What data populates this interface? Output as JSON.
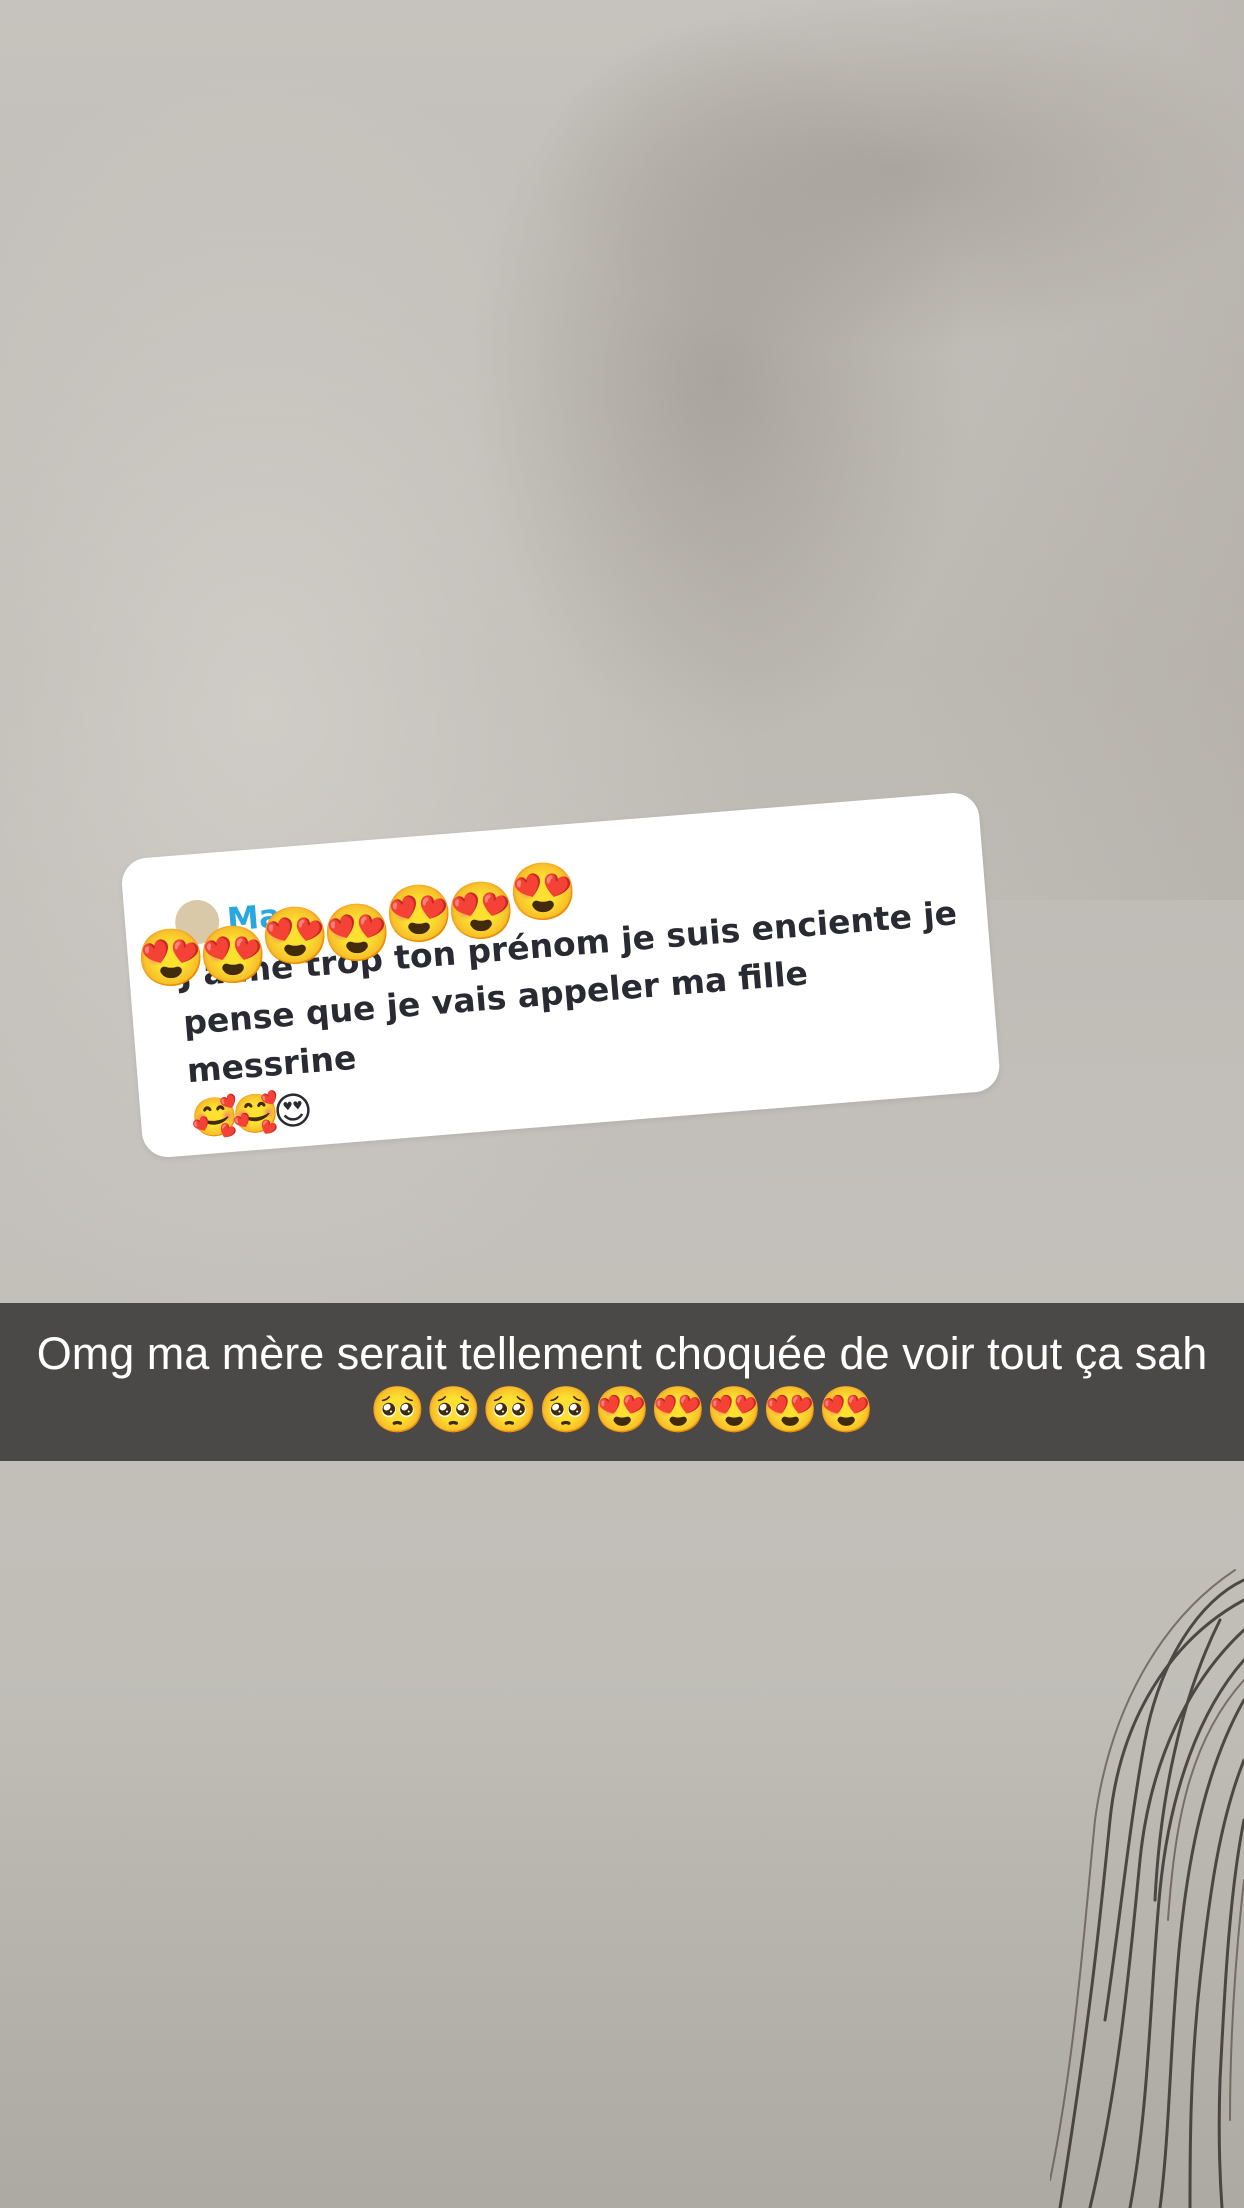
{
  "comment": {
    "username": "Ma",
    "text": "J aime trop ton prénom je suis enciente je pense que je vais appeler ma fille messrine",
    "trailing_emojis": "🥰🥰😍"
  },
  "sticker": {
    "emoji": "😍",
    "count": 7
  },
  "caption": {
    "text": "Omg ma mère serait tellement choquée de voir tout ça sah 🥺🥺🥺🥺😍😍😍😍😍"
  },
  "colors": {
    "username": "#29a8e0",
    "comment_text": "#2a2a33",
    "caption_bar": "#282826",
    "caption_text": "#ffffff"
  }
}
